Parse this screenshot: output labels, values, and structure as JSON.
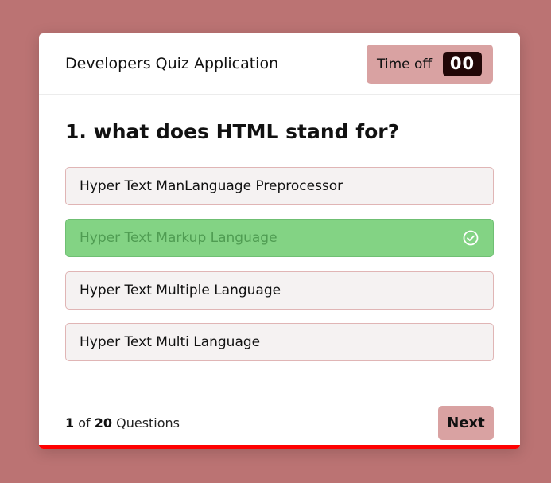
{
  "app": {
    "title": "Developers Quiz Application"
  },
  "timer": {
    "label": "Time off",
    "value": "00"
  },
  "question": {
    "text": "1. what does HTML stand for?"
  },
  "options": [
    {
      "label": "Hyper Text ManLanguage Preprocessor",
      "state": "default"
    },
    {
      "label": "Hyper Text Markup Language",
      "state": "correct",
      "icon": "check-circle-icon"
    },
    {
      "label": "Hyper Text Multiple Language",
      "state": "default"
    },
    {
      "label": "Hyper Text Multi Language",
      "state": "default"
    }
  ],
  "footer": {
    "current": "1",
    "of_text": "of",
    "total": "20",
    "suffix": "Questions",
    "next_label": "Next"
  },
  "progress": {
    "fraction": 1.0
  },
  "colors": {
    "background": "#bb7373",
    "accent": "#d9a2a2",
    "timer_bg": "#210707",
    "correct_bg": "#83d384",
    "correct_text": "#4f9c52",
    "progress": "#ff0000"
  }
}
